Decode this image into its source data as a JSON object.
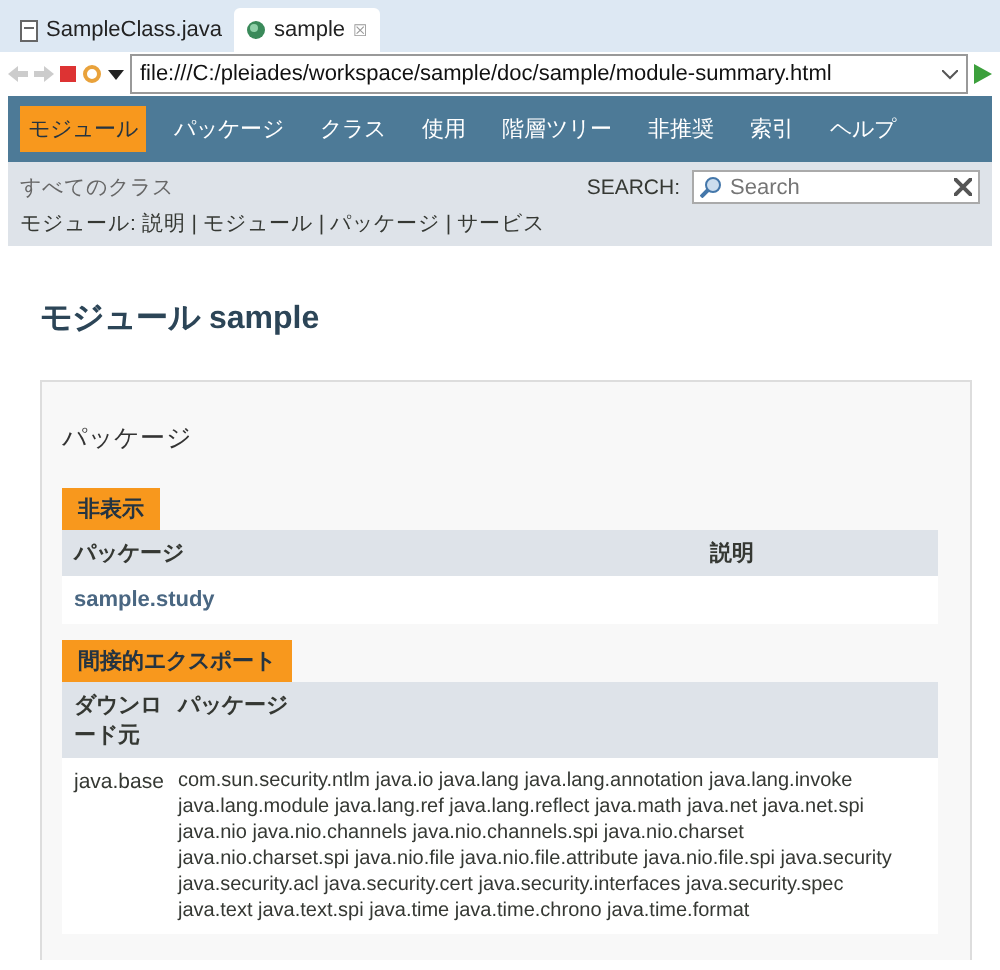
{
  "editor_tabs": [
    {
      "label": "SampleClass.java",
      "selected": false,
      "kind": "java"
    },
    {
      "label": "sample",
      "selected": true,
      "kind": "web",
      "close": "☒"
    }
  ],
  "address": {
    "value": "file:///C:/pleiades/workspace/sample/doc/sample/module-summary.html"
  },
  "nav": {
    "items": [
      {
        "label": "モジュール",
        "selected": true
      },
      {
        "label": "パッケージ",
        "selected": false
      },
      {
        "label": "クラス",
        "selected": false
      },
      {
        "label": "使用",
        "selected": false
      },
      {
        "label": "階層ツリー",
        "selected": false
      },
      {
        "label": "非推奨",
        "selected": false
      },
      {
        "label": "索引",
        "selected": false
      },
      {
        "label": "ヘルプ",
        "selected": false
      }
    ]
  },
  "all_classes": "すべてのクラス",
  "search": {
    "label": "SEARCH:",
    "placeholder": "Search"
  },
  "subnav": "モジュール: 説明 | モジュール | パッケージ | サービス",
  "title": "モジュール sample",
  "section_title": "パッケージ",
  "hidden": {
    "caption": "非表示",
    "columns": [
      "パッケージ",
      "説明"
    ],
    "rows": [
      {
        "package": "sample.study"
      }
    ]
  },
  "indirect": {
    "caption": "間接的エクスポート",
    "columns": [
      "ダウンロード元",
      "パッケージ"
    ],
    "rows": [
      {
        "from": "java.base",
        "lines": [
          "com.sun.security.ntlm java.io java.lang java.lang.annotation java.lang.invoke",
          "java.lang.module java.lang.ref java.lang.reflect java.math java.net java.net.spi",
          "java.nio java.nio.channels java.nio.channels.spi java.nio.charset",
          "java.nio.charset.spi java.nio.file java.nio.file.attribute java.nio.file.spi java.security",
          "java.security.acl java.security.cert java.security.interfaces java.security.spec",
          "java.text java.text.spi java.time java.time.chrono java.time.format"
        ]
      }
    ]
  }
}
